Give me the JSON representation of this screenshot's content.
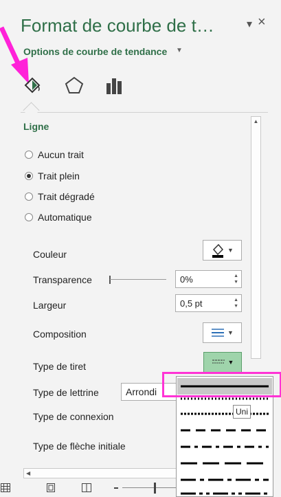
{
  "pane": {
    "title": "Format de courbe de t…",
    "options_label": "Options de courbe de tendance",
    "close_symbol": "×",
    "menu_symbol": "▾"
  },
  "tabs": [
    {
      "icon": "fill-bucket-icon",
      "active": true
    },
    {
      "icon": "pentagon-effects-icon",
      "active": false
    },
    {
      "icon": "bar-chart-icon",
      "active": false
    }
  ],
  "section": {
    "title": "Ligne"
  },
  "line_type": {
    "options": [
      "Aucun trait",
      "Trait plein",
      "Trait dégradé",
      "Automatique"
    ],
    "selected": "Trait plein"
  },
  "props": {
    "color_label": "Couleur",
    "transparency_label": "Transparence",
    "transparency_value": "0%",
    "width_label": "Largeur",
    "width_value": "0,5 pt",
    "composition_label": "Composition",
    "dash_label": "Type de tiret",
    "cap_label": "Type de lettrine",
    "cap_value": "Arrondi",
    "join_label": "Type de connexion",
    "arrow_label": "Type de flèche initiale"
  },
  "tooltip": "Uni",
  "colors": {
    "accent": "#2f6f48",
    "highlight": "#ff33d5",
    "arrow": "#ff22d8"
  }
}
